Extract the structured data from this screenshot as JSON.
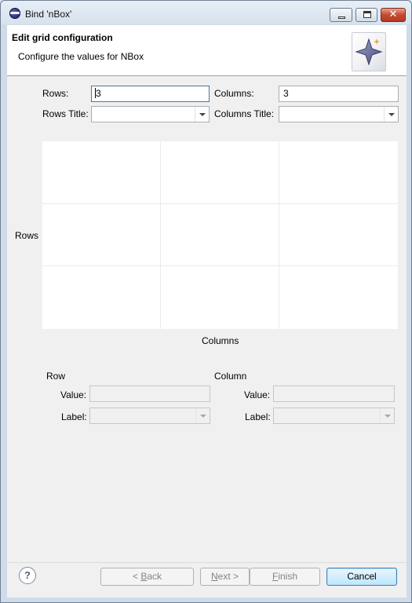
{
  "window": {
    "title": "Bind 'nBox'",
    "close_glyph": "✕"
  },
  "header": {
    "title": "Edit grid configuration",
    "description": "Configure the values for NBox",
    "banner_icon": "wizard-star-icon"
  },
  "form": {
    "rows_label": "Rows:",
    "rows_value": "3",
    "columns_label": "Columns:",
    "columns_value": "3",
    "rows_title_label": "Rows Title:",
    "rows_title_value": "",
    "columns_title_label": "Columns Title:",
    "columns_title_value": ""
  },
  "grid": {
    "rows": 3,
    "columns": 3,
    "rows_axis_label": "Rows",
    "columns_axis_label": "Columns"
  },
  "row_section": {
    "heading": "Row",
    "value_label": "Value:",
    "value": "",
    "label_label": "Label:",
    "label_value": ""
  },
  "column_section": {
    "heading": "Column",
    "value_label": "Value:",
    "value": "",
    "label_label": "Label:",
    "label_value": ""
  },
  "footer": {
    "help_glyph": "?",
    "back_prefix": "< ",
    "back_mnemonic": "B",
    "back_rest": "ack",
    "next_mnemonic": "N",
    "next_rest": "ext >",
    "finish_mnemonic": "F",
    "finish_rest": "inish",
    "cancel_label": "Cancel"
  }
}
